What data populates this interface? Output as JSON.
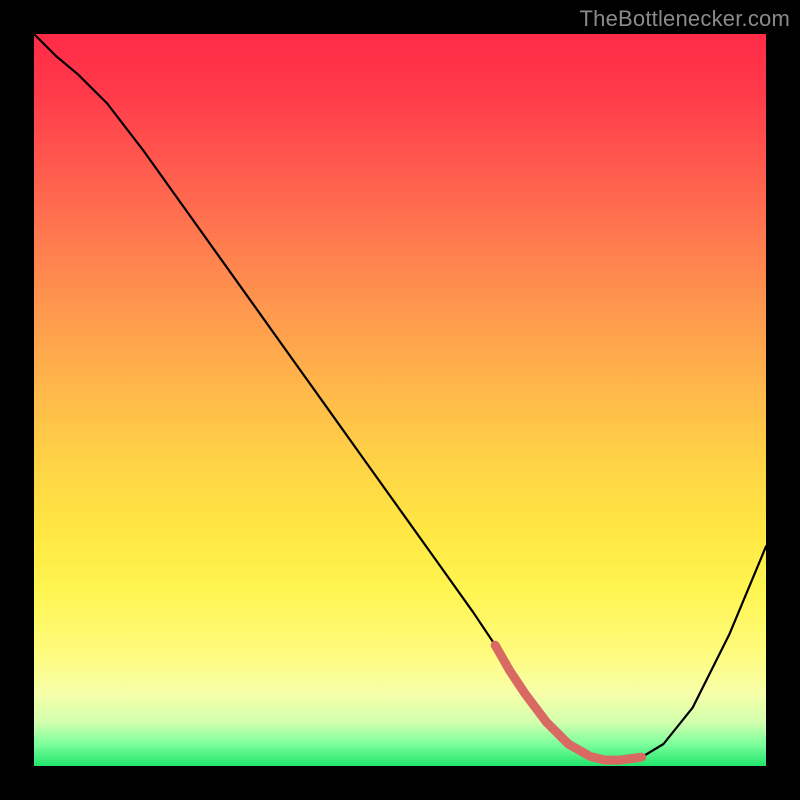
{
  "watermark": "TheBottlenecker.com",
  "colors": {
    "curve": "#000000",
    "highlight": "#d96a63",
    "frame_border": "#000000"
  },
  "chart_data": {
    "type": "line",
    "title": "",
    "xlabel": "",
    "ylabel": "",
    "xlim": [
      0,
      100
    ],
    "ylim": [
      0,
      100
    ],
    "x": [
      0,
      3,
      6,
      10,
      15,
      20,
      25,
      30,
      35,
      40,
      45,
      50,
      55,
      60,
      63,
      65,
      67,
      70,
      73,
      76,
      78,
      80,
      83,
      86,
      90,
      95,
      100
    ],
    "values": [
      100,
      97,
      94.5,
      90.5,
      84,
      77,
      70,
      63,
      56,
      49,
      42,
      35,
      28,
      21,
      16.5,
      13,
      10,
      6,
      3,
      1.3,
      0.8,
      0.8,
      1.2,
      3,
      8,
      18,
      30
    ],
    "highlight_segment": {
      "x": [
        63,
        65,
        67,
        70,
        73,
        76,
        78,
        80,
        83
      ],
      "values": [
        16.5,
        13,
        10,
        6,
        3,
        1.3,
        0.8,
        0.8,
        1.2
      ]
    },
    "grid": false,
    "legend": false
  }
}
